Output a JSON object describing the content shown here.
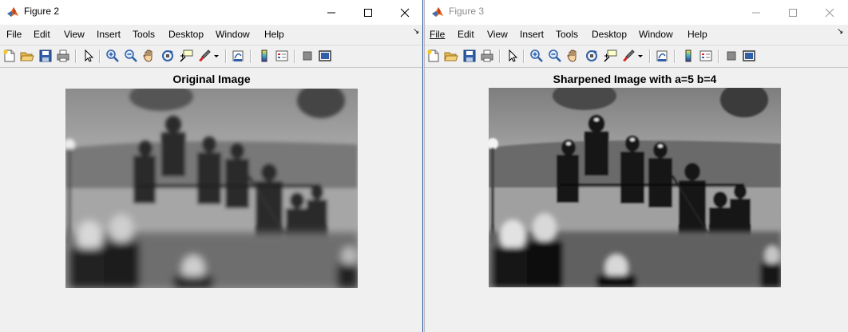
{
  "figure2": {
    "title": "Figure 2",
    "menu": [
      "File",
      "Edit",
      "View",
      "Insert",
      "Tools",
      "Desktop",
      "Window",
      "Help"
    ],
    "plot_title": "Original Image",
    "focus": "active"
  },
  "figure3": {
    "title": "Figure 3",
    "menu": [
      "File",
      "Edit",
      "View",
      "Insert",
      "Tools",
      "Desktop",
      "Window",
      "Help"
    ],
    "plot_title": "Sharpened Image with a=5 b=4",
    "focus": "inactive"
  },
  "toolbar_icons": [
    "new-figure-icon",
    "open-file-icon",
    "save-icon",
    "print-icon",
    "edit-plot-arrow-icon",
    "zoom-in-icon",
    "zoom-out-icon",
    "pan-hand-icon",
    "rotate-3d-icon",
    "data-cursor-icon",
    "brush-icon",
    "brush-menu-arrow-icon",
    "link-plot-icon",
    "insert-colorbar-icon",
    "insert-legend-icon",
    "hide-plot-tools-icon",
    "show-plot-tools-icon"
  ],
  "colors": {
    "window_bg": "#f0f0f0",
    "active_border": "#1e4f9c",
    "inactive_title": "#8c8c8c"
  }
}
